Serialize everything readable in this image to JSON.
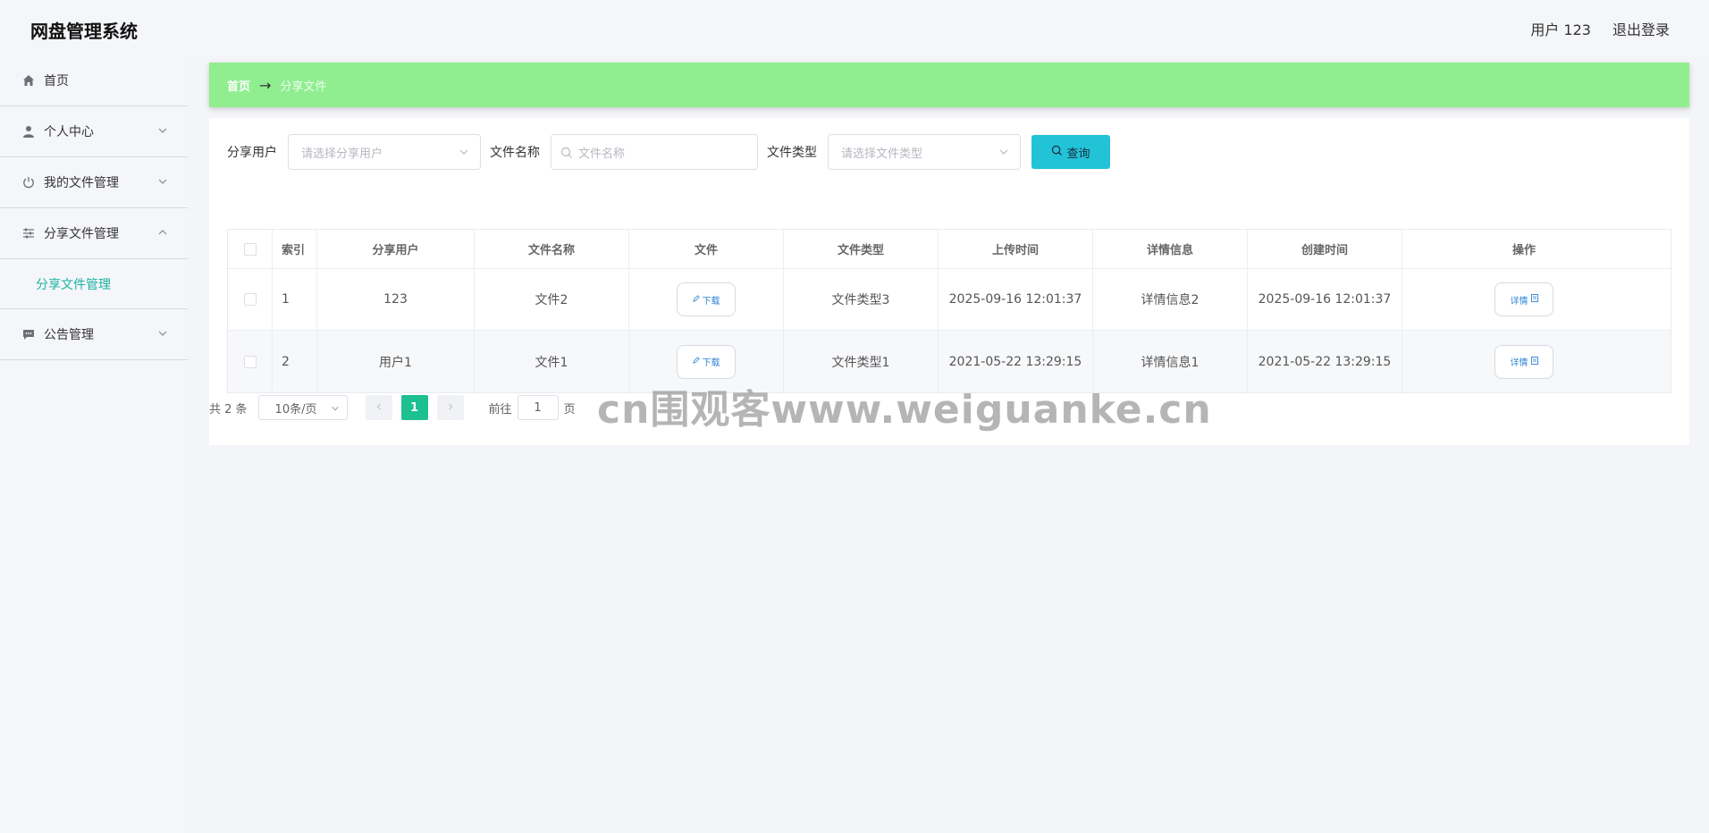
{
  "header": {
    "app_title": "网盘管理系统",
    "user_label": "用户 123",
    "logout_label": "退出登录"
  },
  "sidebar": {
    "items": [
      {
        "label": "首页",
        "icon": "home-icon"
      },
      {
        "label": "个人中心",
        "icon": "user-icon"
      },
      {
        "label": "我的文件管理",
        "icon": "power-icon"
      },
      {
        "label": "分享文件管理",
        "icon": "sliders-icon"
      },
      {
        "label": "公告管理",
        "icon": "chat-icon"
      }
    ],
    "submenu_active": "分享文件管理"
  },
  "breadcrumb": {
    "home": "首页",
    "separator": "→",
    "current": "分享文件"
  },
  "search": {
    "share_user_label": "分享用户",
    "share_user_placeholder": "请选择分享用户",
    "file_name_label": "文件名称",
    "file_name_placeholder": "文件名称",
    "file_type_label": "文件类型",
    "file_type_placeholder": "请选择文件类型",
    "query_label": "查询"
  },
  "table": {
    "headers": [
      "索引",
      "分享用户",
      "文件名称",
      "文件",
      "文件类型",
      "上传时间",
      "详情信息",
      "创建时间",
      "操作"
    ],
    "download_label": "下载",
    "detail_label": "详情",
    "rows": [
      {
        "index": "1",
        "share_user": "123",
        "file_name": "文件2",
        "file_type": "文件类型3",
        "upload_time": "2025-09-16 12:01:37",
        "detail_info": "详情信息2",
        "create_time": "2025-09-16 12:01:37"
      },
      {
        "index": "2",
        "share_user": "用户1",
        "file_name": "文件1",
        "file_type": "文件类型1",
        "upload_time": "2021-05-22 13:29:15",
        "detail_info": "详情信息1",
        "create_time": "2021-05-22 13:29:15"
      }
    ]
  },
  "pagination": {
    "total": "共 2 条",
    "page_size": "10条/页",
    "current_page": "1",
    "goto_prefix": "前往",
    "goto_value": "1",
    "goto_suffix": "页"
  },
  "watermark": "cn围观客www.weiguanke.cn",
  "colors": {
    "breadcrumb_bg": "#90ee90",
    "query_button": "#22c3d7",
    "active_page": "#1dc090",
    "submenu_active": "#1bb3a2"
  }
}
